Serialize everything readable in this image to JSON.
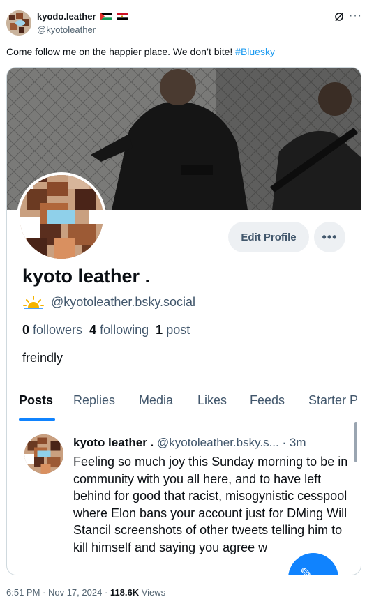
{
  "tweet": {
    "author_name": "kyodo.leather",
    "author_handle": "@kyotoleather",
    "text": "Come follow me on the happier place. We don’t bite!",
    "hashtag": "#Bluesky",
    "time": "6:51 PM · Nov 17, 2024",
    "separator": "·",
    "views_count": "118.6K",
    "views_label": "Views",
    "icons": [
      "grok-icon",
      "more-icon",
      "flag-icon"
    ]
  },
  "profile": {
    "edit_button": "Edit Profile",
    "more_button": "•••",
    "display_name": "kyoto leather .",
    "handle": "@kyotoleather.bsky.social",
    "followers_count": "0",
    "followers_label": "followers",
    "following_count": "4",
    "following_label": "following",
    "posts_count": "1",
    "posts_label": "post",
    "bio": "freindly",
    "tabs": [
      "Posts",
      "Replies",
      "Media",
      "Likes",
      "Feeds",
      "Starter P"
    ],
    "active_tab": "Posts"
  },
  "post": {
    "name": "kyoto leather .",
    "handle": "@kyotoleather.bsky.s...",
    "age": "· 3m",
    "body": "Feeling so much joy this Sunday morning to be in community with you all here, and to have left behind for good that racist, misogynistic cesspool where Elon bans your account just for DMing Will Stancil screenshots of other tweets telling him to kill himself and saying you agree w"
  },
  "colors": {
    "accent": "#1d9bf0",
    "bsky_blue": "#1083fe",
    "muted": "#536471"
  }
}
